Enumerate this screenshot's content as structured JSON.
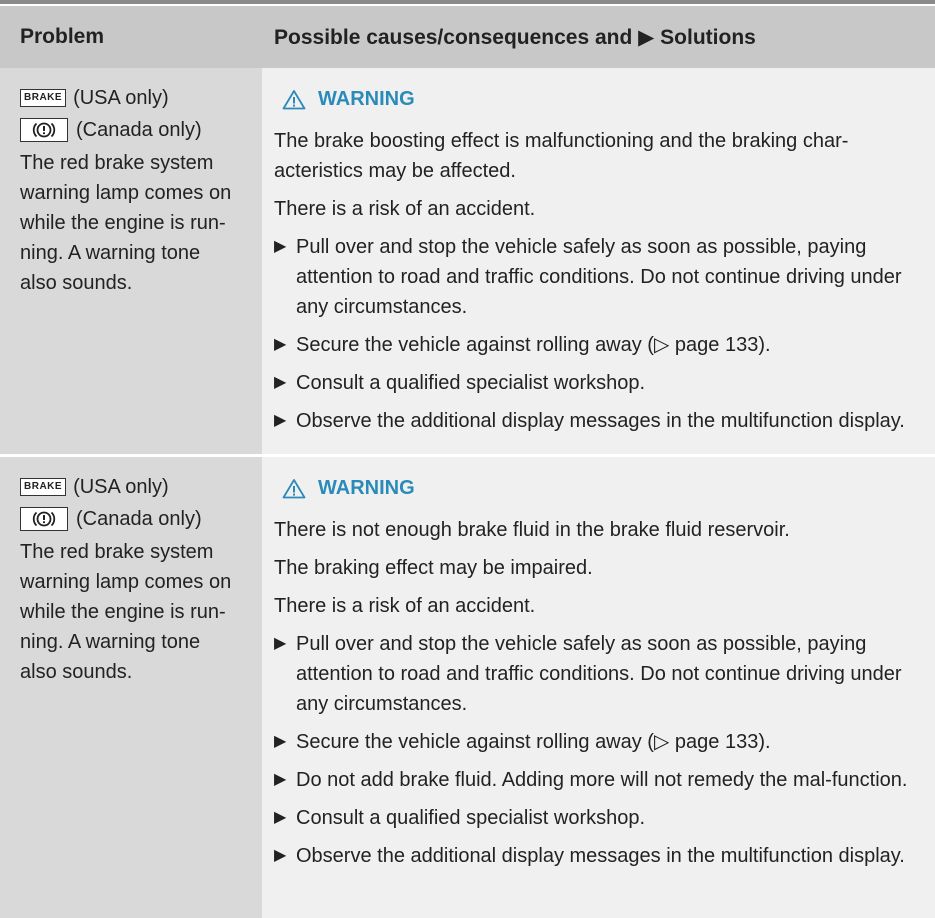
{
  "header": {
    "problem": "Problem",
    "solutions_prefix": "Possible causes/consequences and",
    "solutions_arrow": "▶",
    "solutions_suffix": "Solutions"
  },
  "rows": [
    {
      "lamp_usa_badge": "BRAKE",
      "lamp_usa_label": "(USA only)",
      "lamp_canada_label": "(Canada only)",
      "problem_lines": [
        "The red brake system",
        "warning lamp comes on",
        "while the engine is run-",
        "ning. A warning tone",
        "also sounds."
      ],
      "warning_label": "WARNING",
      "paragraph_lines": [
        "The brake boosting effect is malfunctioning and the braking char-",
        "acteristics may be affected.",
        "There is a risk of an accident."
      ],
      "steps": [
        "Pull over and stop the vehicle safely as soon as possible, paying attention to road and traffic conditions. Do not continue driving under any circumstances.",
        "Secure the vehicle against rolling away (▷ page 133).",
        "Consult a qualified specialist workshop.",
        "Observe the additional display messages in the multifunction display."
      ]
    },
    {
      "lamp_usa_badge": "BRAKE",
      "lamp_usa_label": "(USA only)",
      "lamp_canada_label": "(Canada only)",
      "problem_lines": [
        "The red brake system",
        "warning lamp comes on",
        "while the engine is run-",
        "ning. A warning tone",
        "also sounds."
      ],
      "warning_label": "WARNING",
      "paragraph_lines": [
        "There is not enough brake fluid in the brake fluid reservoir.",
        "The braking effect may be impaired.",
        "There is a risk of an accident."
      ],
      "steps": [
        "Pull over and stop the vehicle safely as soon as possible, paying attention to road and traffic conditions. Do not continue driving under any circumstances.",
        "Secure the vehicle against rolling away (▷ page 133).",
        "Do not add brake fluid. Adding more will not remedy the mal-function.",
        "Consult a qualified specialist workshop.",
        "Observe the additional display messages in the multifunction display."
      ]
    }
  ],
  "step_marker": "▶",
  "colors": {
    "header_bg": "#c8c8c8",
    "problem_bg": "#d9d9d9",
    "solution_bg": "#f0f0f0",
    "warning_accent": "#2a8ab8"
  }
}
